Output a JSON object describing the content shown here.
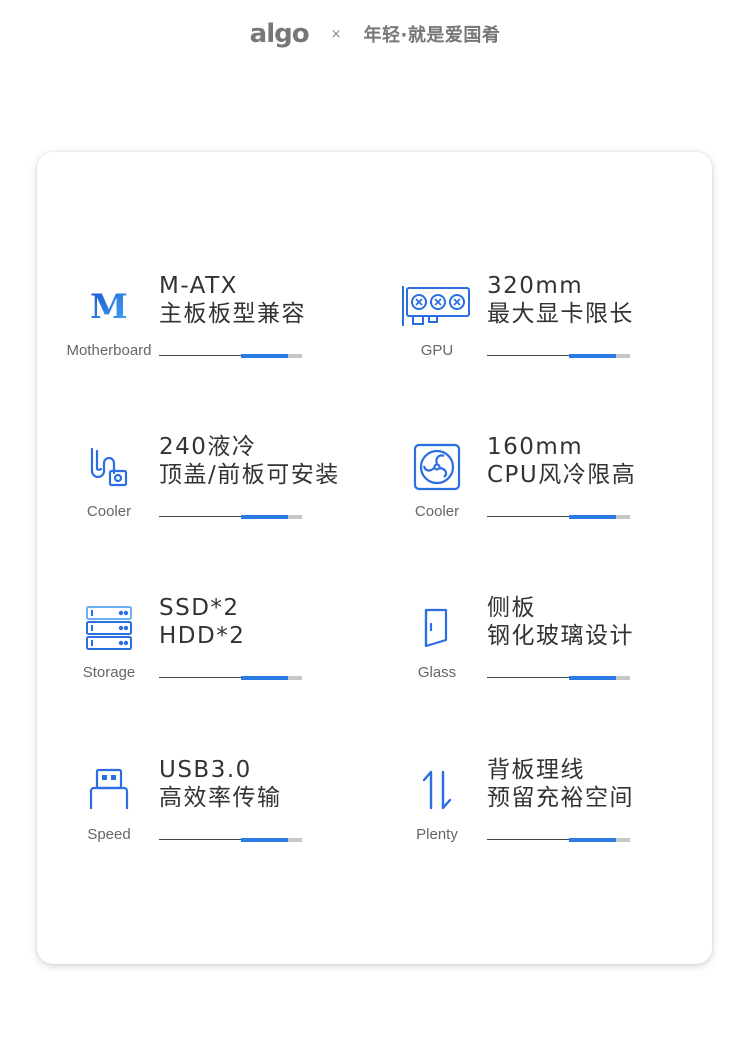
{
  "header": {
    "logo": "algo",
    "separator": "×",
    "slogan": "年轻·就是爱国肴"
  },
  "features": [
    {
      "icon": "motherboard-m-icon",
      "caption": "Motherboard",
      "line1": "M-ATX",
      "line2": "主板板型兼容"
    },
    {
      "icon": "gpu-card-icon",
      "caption": "GPU",
      "line1": "320mm",
      "line2": "最大显卡限长"
    },
    {
      "icon": "liquid-cooler-icon",
      "caption": "Cooler",
      "line1": "240液冷",
      "line2": "顶盖/前板可安装"
    },
    {
      "icon": "fan-cooler-icon",
      "caption": "Cooler",
      "line1": "160mm",
      "line2": "CPU风冷限高"
    },
    {
      "icon": "storage-drives-icon",
      "caption": "Storage",
      "line1": "SSD*2",
      "line2": "HDD*2"
    },
    {
      "icon": "glass-panel-icon",
      "caption": "Glass",
      "line1": "侧板",
      "line2": "钢化玻璃设计"
    },
    {
      "icon": "usb-port-icon",
      "caption": "Speed",
      "line1": "USB3.0",
      "line2": "高效率传输"
    },
    {
      "icon": "cable-routing-icon",
      "caption": "Plenty",
      "line1": "背板理线",
      "line2": "预留充裕空间"
    }
  ],
  "colors": {
    "accent": "#2a7be4",
    "track": "#c8c8c8",
    "text": "#333333"
  }
}
